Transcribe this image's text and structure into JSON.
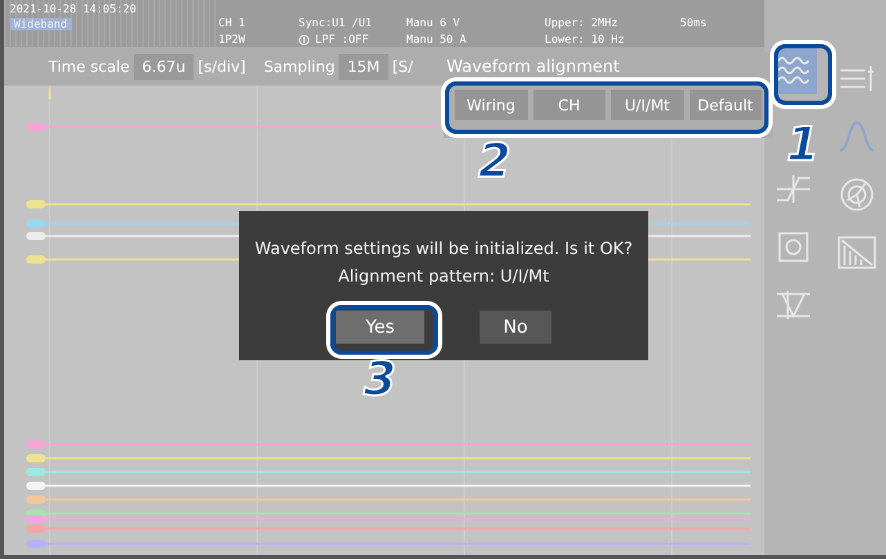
{
  "header": {
    "datetime": "2021-10-28 14:05:20",
    "mode_badge": "Wideband",
    "channel": "CH 1",
    "wiring": "1P2W",
    "sync": "Sync:U1 /U1",
    "lpf": "LPF :OFF",
    "voltage_range": "Manu  6 V",
    "current_range": "Manu  50 A",
    "upper_filter": "Upper:  2MHz",
    "lower_filter": "Lower: 10 Hz",
    "time_div": "50ms"
  },
  "toolbar": {
    "fields": [
      {
        "label": "Time scale",
        "value": "6.67u",
        "unit": "[s/div]"
      },
      {
        "label": "Sampling",
        "value": "15M",
        "unit": "[S/"
      }
    ]
  },
  "alignment_panel": {
    "title": "Waveform alignment",
    "buttons": [
      {
        "label": "Wiring"
      },
      {
        "label": "CH"
      },
      {
        "label": "U/I/Mt"
      },
      {
        "label": "Default"
      }
    ]
  },
  "dialog": {
    "message": "Waveform settings will be initialized. Is it OK?",
    "detail": "Alignment pattern: U/I/Mt",
    "buttons": [
      {
        "label": "Yes",
        "selected": true
      },
      {
        "label": "No",
        "selected": false
      }
    ]
  },
  "sidebar": {
    "items": [
      {
        "kind": "align",
        "selected": true
      },
      {
        "kind": "trigger",
        "selected": false
      },
      {
        "kind": "save",
        "selected": false
      },
      {
        "kind": "scale",
        "selected": false
      },
      {
        "kind": "value",
        "selected": false
      },
      {
        "kind": "wave",
        "selected": false
      },
      {
        "kind": "vector",
        "selected": false
      },
      {
        "kind": "harmonic",
        "selected": false
      }
    ]
  },
  "callouts": [
    "1",
    "2",
    "3"
  ]
}
